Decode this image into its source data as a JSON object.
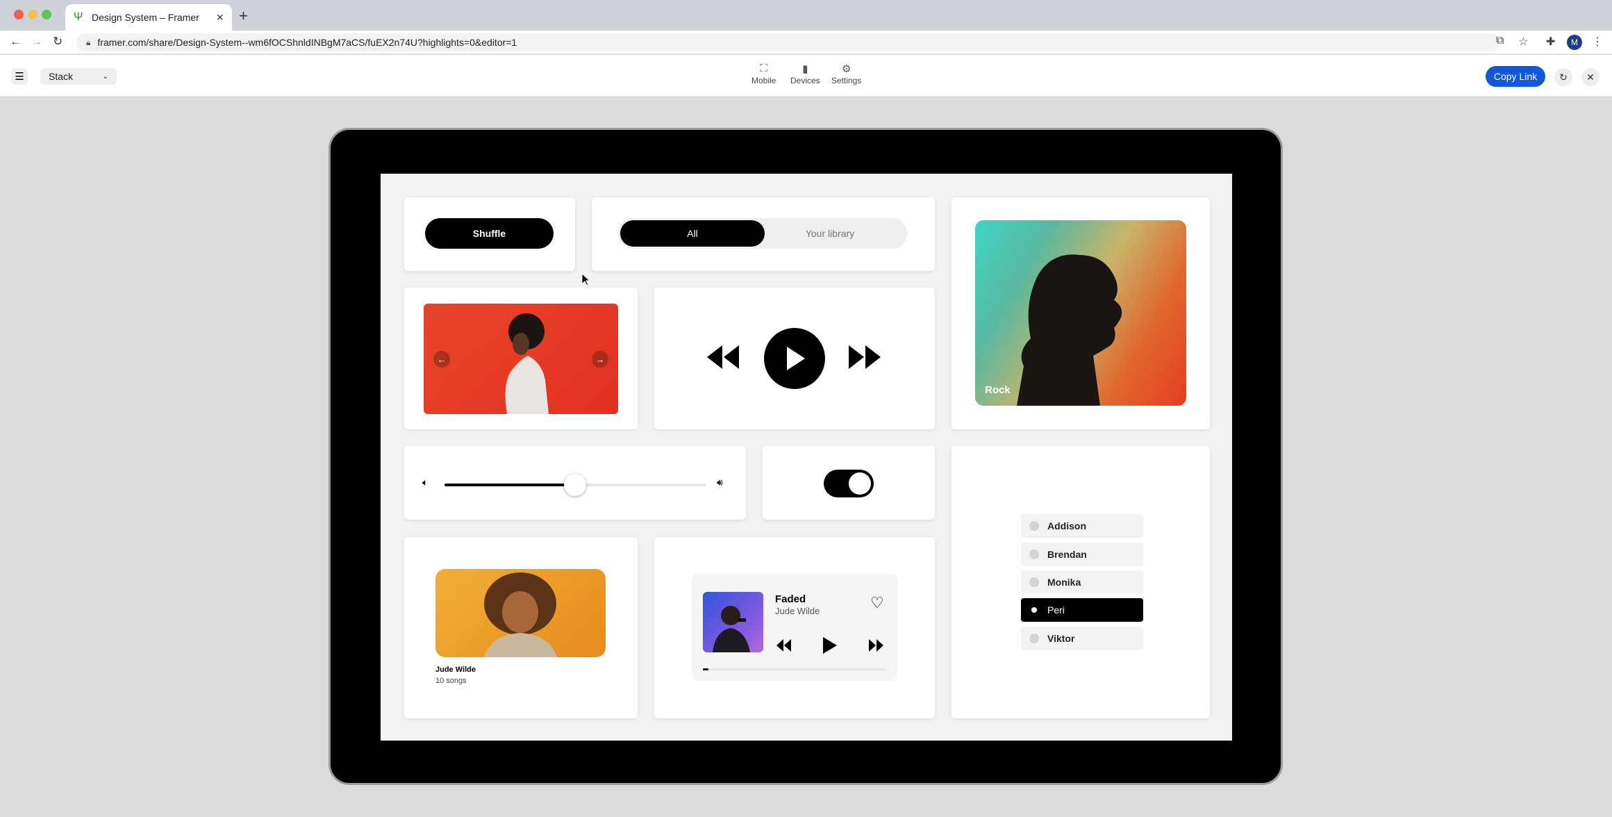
{
  "browser": {
    "tab_title": "Design System – Framer",
    "url": "framer.com/share/Design-System--wm6fOCShnldINBgM7aCS/fuEX2n74U?highlights=0&editor=1",
    "avatar_letter": "M"
  },
  "toolbar": {
    "stack_label": "Stack",
    "items": [
      {
        "label": "Mobile",
        "icon": "mobile-frame-icon"
      },
      {
        "label": "Devices",
        "icon": "devices-icon"
      },
      {
        "label": "Settings",
        "icon": "sliders-icon"
      }
    ],
    "copy_link": "Copy Link"
  },
  "canvas": {
    "shuffle_label": "Shuffle",
    "segment": {
      "active": "All",
      "inactive": "Your library"
    },
    "genre_label": "Rock",
    "volume_level": 0.5,
    "toggle_on": true,
    "artist_card": {
      "name": "Jude Wilde",
      "count": "10 songs"
    },
    "player": {
      "title": "Faded",
      "artist": "Jude Wilde",
      "progress": 0.03
    },
    "radio_options": [
      "Addison",
      "Brendan",
      "Monika",
      "Peri",
      "Viktor"
    ],
    "radio_selected": "Peri"
  },
  "colors": {
    "accent": "#1358d8",
    "dark": "#000000"
  }
}
